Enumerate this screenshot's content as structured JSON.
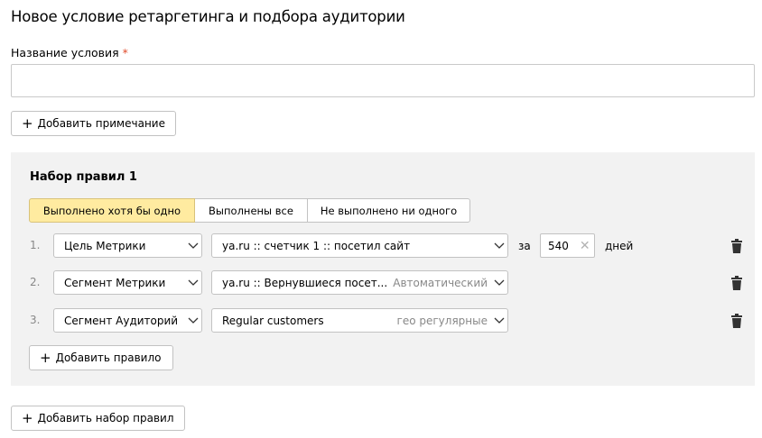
{
  "page_title": "Новое условие ретаргетинга и подбора аудитории",
  "name_field": {
    "label": "Название условия",
    "required_mark": "*",
    "value": "",
    "placeholder": ""
  },
  "add_note_label": "Добавить примечание",
  "ruleset": {
    "title": "Набор правил 1",
    "modes": [
      "Выполнено хотя бы одно",
      "Выполнены все",
      "Не выполнено ни одного"
    ],
    "active_mode": 0,
    "rules": [
      {
        "num": "1.",
        "type": "Цель Метрики",
        "value": "ya.ru :: счетчик 1 :: посетил сайт",
        "extra": "",
        "period_prefix": "за",
        "days": "540",
        "period_suffix": "дней"
      },
      {
        "num": "2.",
        "type": "Сегмент Метрики",
        "value": "ya.ru :: Вернувшиеся посет...",
        "extra": "Автоматический"
      },
      {
        "num": "3.",
        "type": "Сегмент Аудиторий",
        "value": "Regular customers",
        "extra": "гео регулярные"
      }
    ],
    "add_rule_label": "Добавить правило"
  },
  "add_ruleset_label": "Добавить набор правил",
  "colors": {
    "active_mode_bg": "#ffeba0",
    "ruleset_bg": "#f2f2f2",
    "required": "#e04a2a"
  }
}
